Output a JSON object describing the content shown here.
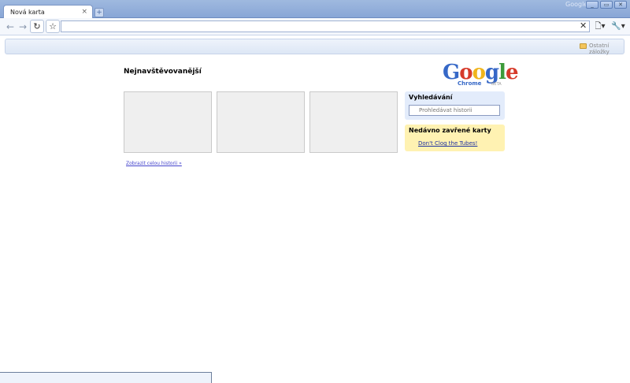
{
  "window": {
    "app_label": "Google",
    "controls": {
      "minimize": "_",
      "restore": "▭",
      "close": "✕"
    }
  },
  "tab": {
    "title": "Nová karta",
    "close": "×"
  },
  "new_tab": {
    "label": "+"
  },
  "toolbar": {
    "back": "←",
    "forward": "→",
    "reload": "↻",
    "star": "☆",
    "clear": "✕",
    "page_menu": "🗋▾",
    "tools_menu": "🔧▾",
    "address_value": ""
  },
  "bookmarks": {
    "other": "Ostatní záložky"
  },
  "most_visited": {
    "title": "Nejnavštěvovanější",
    "thumbnails": [
      "",
      "",
      ""
    ],
    "show_history": "Zobrazit celou historii »"
  },
  "logo": {
    "word": "Google",
    "sub": "Chrome",
    "badge": "BETA"
  },
  "search": {
    "title": "Vyhledávání",
    "placeholder": "Prohledávat historii"
  },
  "recent": {
    "title": "Nedávno zavřené karty",
    "item": "Don't Clog the Tubes!"
  },
  "colors": {
    "titlebar": "#9fb9df",
    "search_panel": "#e3ecfb",
    "recent_panel": "#fff2b2",
    "link": "#1d31a0"
  }
}
